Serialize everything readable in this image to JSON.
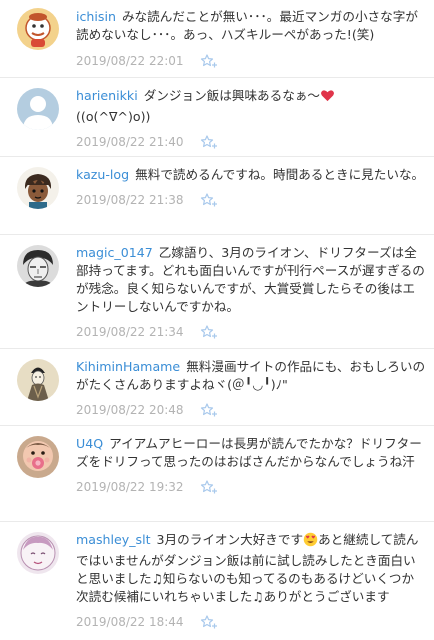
{
  "comments": [
    {
      "username": "ichisin",
      "text": "みな読んだことが無い･･･。最近マンガの小さな字が読めないなし･･･。あっ、ハズキルーペがあった!(笑)",
      "timestamp": "2019/08/22 22:01",
      "avatar": "cartoon-character-avatar"
    },
    {
      "username": "harienikki",
      "text": "ダンジョン飯は興味あるなぁ〜",
      "text_suffix": "((o(^∇^)o))",
      "emoji": "heart",
      "timestamp": "2019/08/22 21:40",
      "avatar": "default-silhouette-avatar"
    },
    {
      "username": "kazu-log",
      "text": "無料で読めるんですね。時間あるときに見たいな。",
      "timestamp": "2019/08/22 21:38",
      "avatar": "anime-character-avatar"
    },
    {
      "username": "magic_0147",
      "text": "乙嫁語り、3月のライオン、ドリフターズは全部持ってます。どれも面白いんですが刊行ペースが遅すぎるのが残念。良く知らないんですが、大賞受賞したらその後はエントリーしないんですかね。",
      "timestamp": "2019/08/22 21:34",
      "avatar": "sketch-portrait-avatar"
    },
    {
      "username": "KihiminHamame",
      "text": "無料漫画サイトの作品にも、おもしろいのがたくさんありますよねヾ(＠╹◡╹)ﾉ\"",
      "timestamp": "2019/08/22 20:48",
      "avatar": "ukiyoe-figure-avatar"
    },
    {
      "username": "U4Q",
      "text": "アイアムアヒーローは長男が読んでたかな？ドリフターズをドリフって思ったのはおばさんだからなんでしょうね汗",
      "timestamp": "2019/08/22 19:32",
      "avatar": "baby-with-pacifier-avatar"
    },
    {
      "username": "mashley_slt",
      "text": "3月のライオン大好きです",
      "text_suffix": "あと継続して読んではいませんがダンジョン飯は前に試し読みしたとき面白いと思いました♫知らないのも知ってるのもあるけどいくつか次読む候補にいれちゃいました♫ありがとうございます",
      "emoji": "heart-eyes-face",
      "timestamp": "2019/08/22 18:44",
      "avatar": "sketch-face-avatar"
    }
  ],
  "icons": {
    "star": "star-add-icon"
  },
  "colors": {
    "username": "#3b8ed6",
    "text": "#333333",
    "timestamp": "#b3b3b3",
    "star": "#a9c9ec",
    "divider": "#eaeaea",
    "heart": "#e0344a"
  }
}
